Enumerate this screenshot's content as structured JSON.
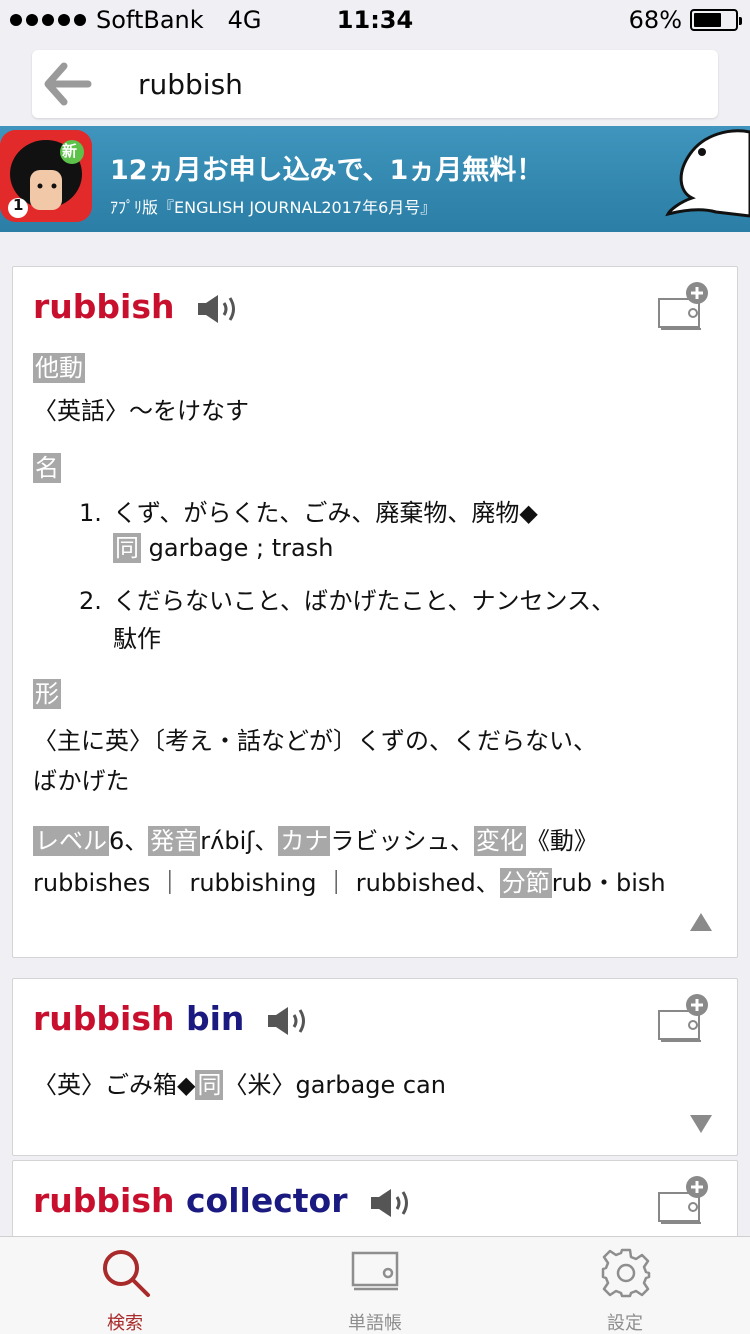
{
  "status": {
    "carrier": "SoftBank",
    "network": "4G",
    "time": "11:34",
    "battery": "68%",
    "battery_level": 0.68
  },
  "search": {
    "query": "rubbish"
  },
  "banner": {
    "badge": "新",
    "icon_number": "1",
    "title": "12ヵ月お申し込みで、1ヵ月無料！",
    "subtitle": "ｱﾌﾟﾘ版『ENGLISH JOURNAL2017年6月号』"
  },
  "entry1": {
    "headword": "rubbish",
    "pos_verb": "他動",
    "verb_def": "〈英話〉～をけなす",
    "pos_noun": "名",
    "noun_def1_num": "1.",
    "noun_def1": "くず、がらくた、ごみ、廃棄物、廃物◆",
    "syn_tag": "同",
    "syn_text": "garbage ; trash",
    "noun_def2_num": "2.",
    "noun_def2_line1": "くだらないこと、ばかげたこと、ナンセンス、",
    "noun_def2_line2": "駄作",
    "pos_adj": "形",
    "adj_def_line1": "〈主に英〉〔考え・話などが〕くずの、くだらない、",
    "adj_def_line2": "ばかげた",
    "level_tag": "レベル",
    "level_value": "6、",
    "pron_tag": "発音",
    "pron_value": "rʌ́biʃ、",
    "kana_tag": "カナ",
    "kana_value": "ラビッシュ、",
    "inflect_tag": "変化",
    "inflect_value": "《動》",
    "inflect_forms": "rubbishes ｜ rubbishing ｜ rubbished、",
    "syllab_tag": "分節",
    "syllab_value": "rub・bish"
  },
  "entry2": {
    "headword_part1": "rubbish",
    "headword_part2": "bin",
    "def_part1": "〈英〉ごみ箱◆",
    "syn_tag": "同",
    "def_part2": "〈米〉garbage can"
  },
  "entry3": {
    "headword_part1": "rubbish",
    "headword_part2": "collector"
  },
  "tabs": [
    {
      "label": "検索",
      "icon": "search-icon",
      "active": true
    },
    {
      "label": "単語帳",
      "icon": "wordbook-icon",
      "active": false
    },
    {
      "label": "設定",
      "icon": "gear-icon",
      "active": false
    }
  ],
  "colors": {
    "headword_red": "#c8102e",
    "headword_blue": "#1a1a80",
    "tag_gray": "#a8a8a8",
    "active_tab": "#a82a2a",
    "banner_blue": "#3a8fb8"
  }
}
